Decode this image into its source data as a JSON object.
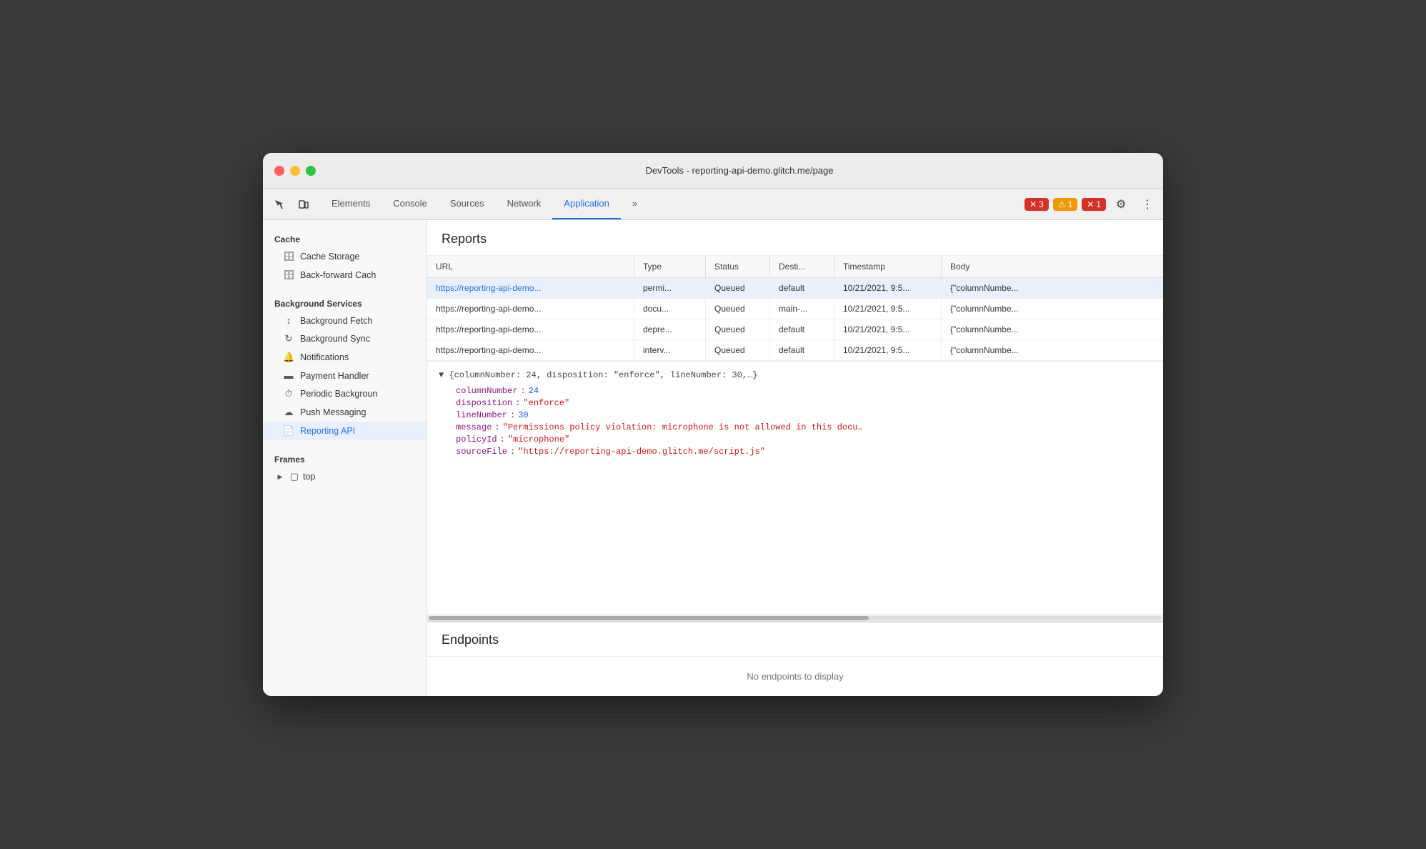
{
  "window": {
    "title": "DevTools - reporting-api-demo.glitch.me/page"
  },
  "toolbar": {
    "tabs": [
      {
        "id": "elements",
        "label": "Elements",
        "active": false
      },
      {
        "id": "console",
        "label": "Console",
        "active": false
      },
      {
        "id": "sources",
        "label": "Sources",
        "active": false
      },
      {
        "id": "network",
        "label": "Network",
        "active": false
      },
      {
        "id": "application",
        "label": "Application",
        "active": true
      }
    ],
    "more_label": "»",
    "error_count": "3",
    "warning_count": "1",
    "error2_count": "1",
    "gear_icon": "⚙",
    "more_icon": "⋮"
  },
  "sidebar": {
    "sections": [
      {
        "label": "Cache",
        "items": [
          {
            "id": "cache-storage",
            "label": "Cache Storage",
            "icon": "🗄",
            "active": false
          },
          {
            "id": "back-forward-cache",
            "label": "Back-forward Cach",
            "icon": "🗄",
            "active": false
          }
        ]
      },
      {
        "label": "Background Services",
        "items": [
          {
            "id": "background-fetch",
            "label": "Background Fetch",
            "icon": "↕",
            "active": false
          },
          {
            "id": "background-sync",
            "label": "Background Sync",
            "icon": "↻",
            "active": false
          },
          {
            "id": "notifications",
            "label": "Notifications",
            "icon": "🔔",
            "active": false
          },
          {
            "id": "payment-handler",
            "label": "Payment Handler",
            "icon": "▬",
            "active": false
          },
          {
            "id": "periodic-background",
            "label": "Periodic Backgroun",
            "icon": "⏱",
            "active": false
          },
          {
            "id": "push-messaging",
            "label": "Push Messaging",
            "icon": "☁",
            "active": false
          },
          {
            "id": "reporting-api",
            "label": "Reporting API",
            "icon": "📄",
            "active": true
          }
        ]
      },
      {
        "label": "Frames",
        "items": [
          {
            "id": "top",
            "label": "top",
            "icon": "▶",
            "active": false
          }
        ]
      }
    ]
  },
  "reports": {
    "title": "Reports",
    "columns": [
      "URL",
      "Type",
      "Status",
      "Desti...",
      "Timestamp",
      "Body"
    ],
    "rows": [
      {
        "url": "https://reporting-api-demo...",
        "type": "permi...",
        "status": "Queued",
        "destination": "default",
        "timestamp": "10/21/2021, 9:5...",
        "body": "{\"columnNumbe...",
        "selected": true
      },
      {
        "url": "https://reporting-api-demo...",
        "type": "docu...",
        "status": "Queued",
        "destination": "main-...",
        "timestamp": "10/21/2021, 9:5...",
        "body": "{\"columnNumbe...",
        "selected": false
      },
      {
        "url": "https://reporting-api-demo...",
        "type": "depre...",
        "status": "Queued",
        "destination": "default",
        "timestamp": "10/21/2021, 9:5...",
        "body": "{\"columnNumbe...",
        "selected": false
      },
      {
        "url": "https://reporting-api-demo...",
        "type": "interv...",
        "status": "Queued",
        "destination": "default",
        "timestamp": "10/21/2021, 9:5...",
        "body": "{\"columnNumbe...",
        "selected": false
      }
    ],
    "detail": {
      "summary": "▼ {columnNumber: 24, disposition: \"enforce\", lineNumber: 30,…}",
      "fields": [
        {
          "name": "columnNumber",
          "colon": ":",
          "value": "24",
          "type": "number"
        },
        {
          "name": "disposition",
          "colon": ":",
          "value": "\"enforce\"",
          "type": "string"
        },
        {
          "name": "lineNumber",
          "colon": ":",
          "value": "30",
          "type": "number"
        },
        {
          "name": "message",
          "colon": ":",
          "value": "\"Permissions policy violation: microphone is not allowed in this docu…",
          "type": "string"
        },
        {
          "name": "policyId",
          "colon": ":",
          "value": "\"microphone\"",
          "type": "string"
        },
        {
          "name": "sourceFile",
          "colon": ":",
          "value": "\"https://reporting-api-demo.glitch.me/script.js\"",
          "type": "string"
        }
      ]
    }
  },
  "endpoints": {
    "title": "Endpoints",
    "empty_message": "No endpoints to display"
  }
}
